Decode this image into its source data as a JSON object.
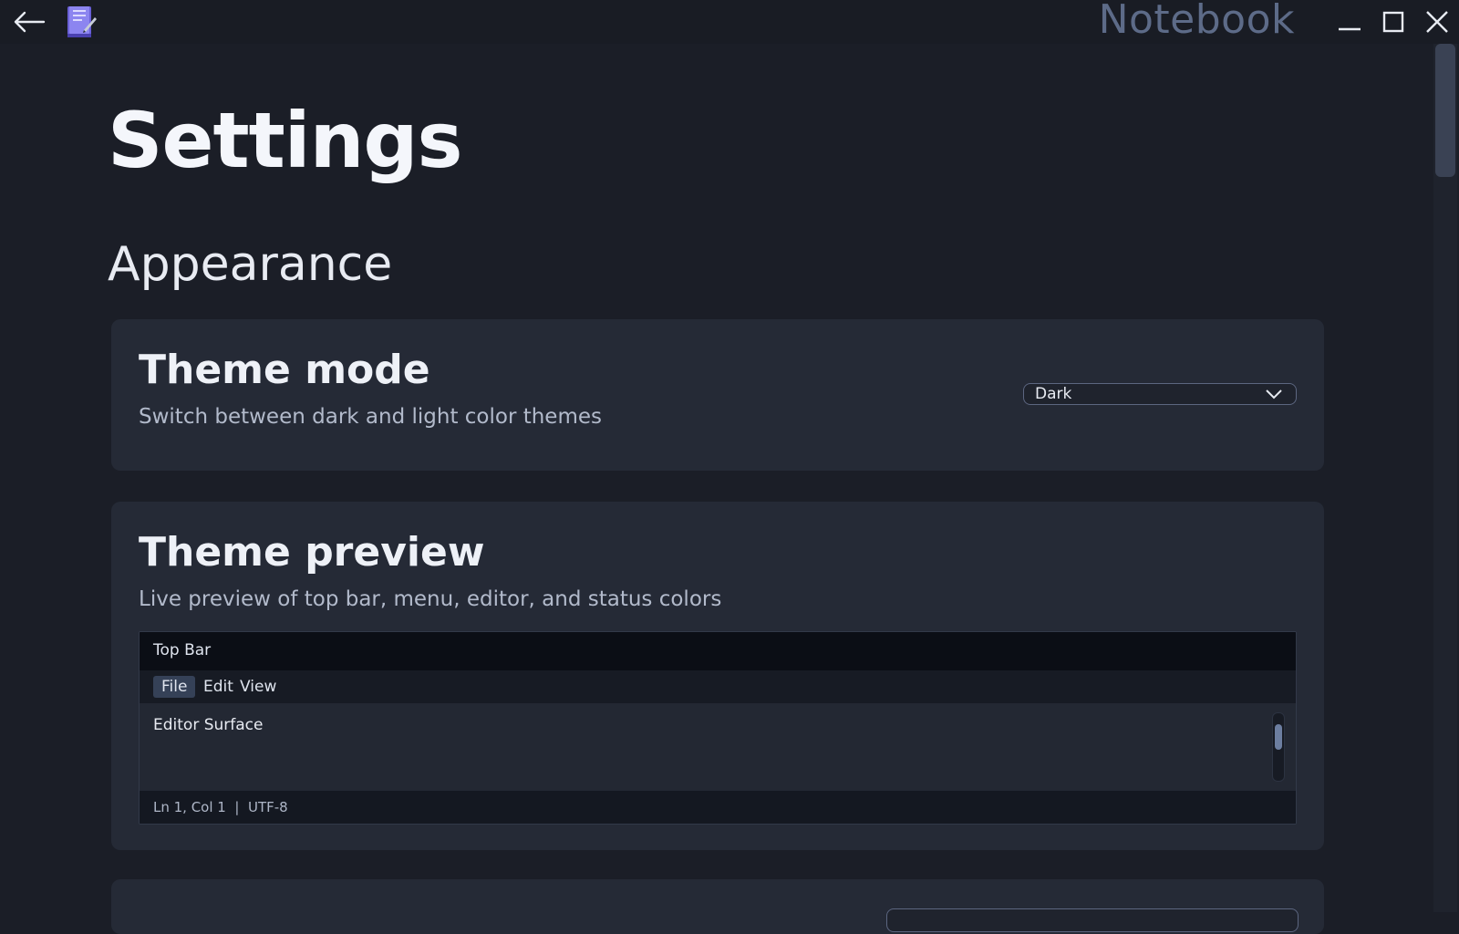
{
  "window": {
    "title": "Notebook"
  },
  "page": {
    "title": "Settings",
    "section_title": "Appearance"
  },
  "theme_mode": {
    "heading": "Theme mode",
    "description": "Switch between dark and light color themes",
    "selected": "Dark"
  },
  "theme_preview": {
    "heading": "Theme preview",
    "description": "Live preview of top bar, menu, editor, and status colors",
    "top_bar_label": "Top Bar",
    "menu": [
      "File",
      "Edit",
      "View"
    ],
    "editor_label": "Editor Surface",
    "status_label": "Ln 1, Col 1  |  UTF-8"
  },
  "colors": {
    "background": "#1b1e27",
    "card": "#252a36",
    "title_gray": "#5d6b88",
    "app_icon": "#6a60d8"
  }
}
